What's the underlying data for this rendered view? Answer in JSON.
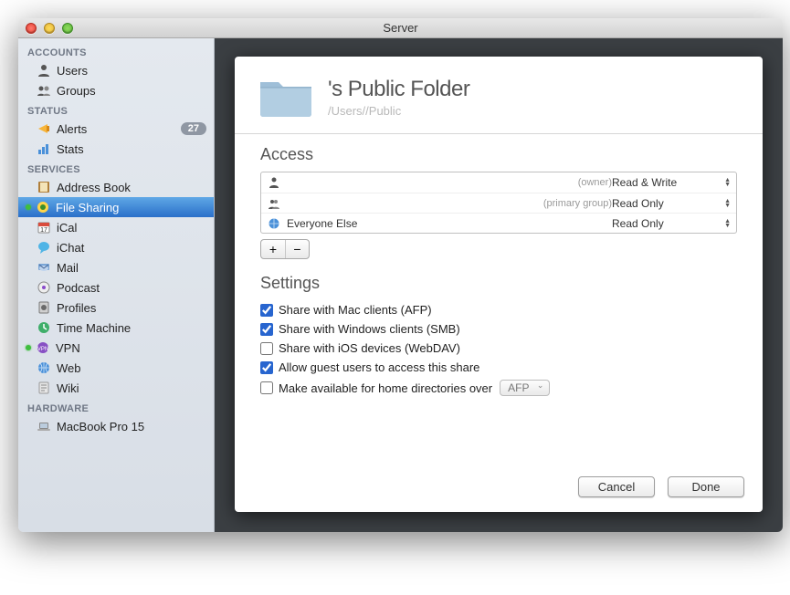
{
  "window": {
    "title": "Server"
  },
  "sidebar": {
    "sections": [
      {
        "title": "ACCOUNTS",
        "items": [
          {
            "label": "Users",
            "icon": "user-icon"
          },
          {
            "label": "Groups",
            "icon": "group-icon"
          }
        ]
      },
      {
        "title": "STATUS",
        "items": [
          {
            "label": "Alerts",
            "icon": "alert-icon",
            "badge": "27"
          },
          {
            "label": "Stats",
            "icon": "stats-icon"
          }
        ]
      },
      {
        "title": "SERVICES",
        "items": [
          {
            "label": "Address Book",
            "icon": "addressbook-icon"
          },
          {
            "label": "File Sharing",
            "icon": "filesharing-icon",
            "status": "green",
            "selected": true
          },
          {
            "label": "iCal",
            "icon": "ical-icon"
          },
          {
            "label": "iChat",
            "icon": "ichat-icon"
          },
          {
            "label": "Mail",
            "icon": "mail-icon"
          },
          {
            "label": "Podcast",
            "icon": "podcast-icon"
          },
          {
            "label": "Profiles",
            "icon": "profiles-icon"
          },
          {
            "label": "Time Machine",
            "icon": "timemachine-icon"
          },
          {
            "label": "VPN",
            "icon": "vpn-icon",
            "status": "green"
          },
          {
            "label": "Web",
            "icon": "web-icon"
          },
          {
            "label": "Wiki",
            "icon": "wiki-icon"
          }
        ]
      },
      {
        "title": "HARDWARE",
        "items": [
          {
            "label": "MacBook Pro 15",
            "icon": "macbook-icon"
          }
        ]
      }
    ]
  },
  "sheet": {
    "title_prefix": "",
    "title_suffix": "'s Public Folder",
    "path_prefix": "/Users/",
    "path_mid": "",
    "path_suffix": "/Public"
  },
  "access": {
    "heading": "Access",
    "rows": [
      {
        "name": "",
        "type": "(owner)",
        "perm": "Read & Write",
        "icon": "person-icon"
      },
      {
        "name": "",
        "type": "(primary group)",
        "perm": "Read Only",
        "icon": "people-icon"
      },
      {
        "name": "Everyone Else",
        "type": "",
        "perm": "Read Only",
        "icon": "globe-icon"
      }
    ],
    "add_label": "+",
    "remove_label": "−"
  },
  "settings": {
    "heading": "Settings",
    "items": [
      {
        "label": "Share with Mac clients (AFP)",
        "checked": true
      },
      {
        "label": "Share with Windows clients (SMB)",
        "checked": true
      },
      {
        "label": "Share with iOS devices (WebDAV)",
        "checked": false
      },
      {
        "label": "Allow guest users to access this share",
        "checked": true
      },
      {
        "label": "Make available for home directories over",
        "checked": false,
        "select": "AFP"
      }
    ]
  },
  "buttons": {
    "cancel": "Cancel",
    "done": "Done"
  }
}
